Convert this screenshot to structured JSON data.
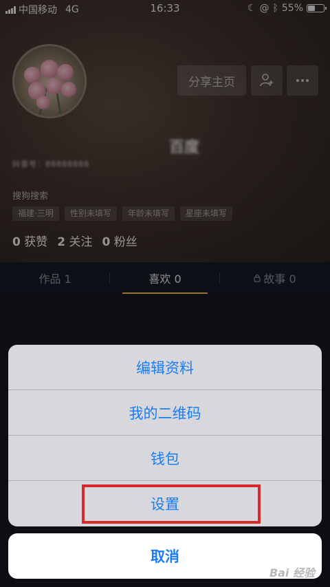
{
  "status_bar": {
    "carrier": "中国移动",
    "network": "4G",
    "time": "16:33",
    "battery": "55%",
    "battery_level": 0.55
  },
  "profile": {
    "share_label": "分享主页",
    "nickname": "百度",
    "user_id": "抖音号：88888888",
    "signature": "搜狗搜索",
    "tags": [
      "福建·三明",
      "性别未填写",
      "年龄未填写",
      "星座未填写"
    ],
    "stats": [
      {
        "count": "0",
        "label": "获赞"
      },
      {
        "count": "2",
        "label": "关注"
      },
      {
        "count": "0",
        "label": "粉丝"
      }
    ]
  },
  "tabs": [
    {
      "label": "作品 1"
    },
    {
      "label": "喜欢 0"
    },
    {
      "label": "故事 0"
    }
  ],
  "action_sheet": {
    "items": [
      "编辑资料",
      "我的二维码",
      "钱包",
      "设置"
    ],
    "cancel": "取消"
  },
  "watermark": "Bai 经验",
  "colors": {
    "accent": "#1a7cf2",
    "highlight": "#d7282a",
    "tab_indicator": "#f0c040"
  }
}
